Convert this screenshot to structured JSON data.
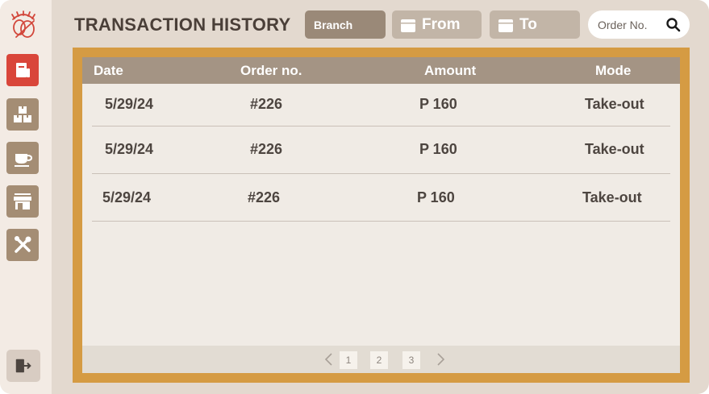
{
  "header": {
    "title": "TRANSACTION HISTORY",
    "branch_label": "Branch",
    "from_label": "From",
    "to_label": "To",
    "search_placeholder": "Order No."
  },
  "sidebar": {
    "items": [
      {
        "name": "transactions",
        "icon": "receipt-icon",
        "active": true
      },
      {
        "name": "inventory",
        "icon": "boxes-icon",
        "active": false
      },
      {
        "name": "menu",
        "icon": "coffee-cup-icon",
        "active": false
      },
      {
        "name": "branches",
        "icon": "store-icon",
        "active": false
      },
      {
        "name": "settings",
        "icon": "tools-icon",
        "active": false
      }
    ],
    "logout_icon": "logout-icon"
  },
  "table": {
    "columns": [
      "Date",
      "Order no.",
      "Amount",
      "Mode"
    ],
    "rows": [
      {
        "date": "5/29/24",
        "order": "#226",
        "amount": "P 160",
        "mode": "Take-out"
      },
      {
        "date": "5/29/24",
        "order": "#226",
        "amount": "P 160",
        "mode": "Take-out"
      },
      {
        "date": "5/29/24",
        "order": "#226",
        "amount": "P 160",
        "mode": "Take-out"
      }
    ]
  },
  "pagination": {
    "pages": [
      "1",
      "2",
      "3"
    ],
    "prev_icon": "chevron-left-icon",
    "next_icon": "chevron-right-icon"
  },
  "colors": {
    "accent": "#d59b43",
    "active_nav": "#d9463a",
    "nav": "#a48d74",
    "header_bg": "#a49484"
  }
}
